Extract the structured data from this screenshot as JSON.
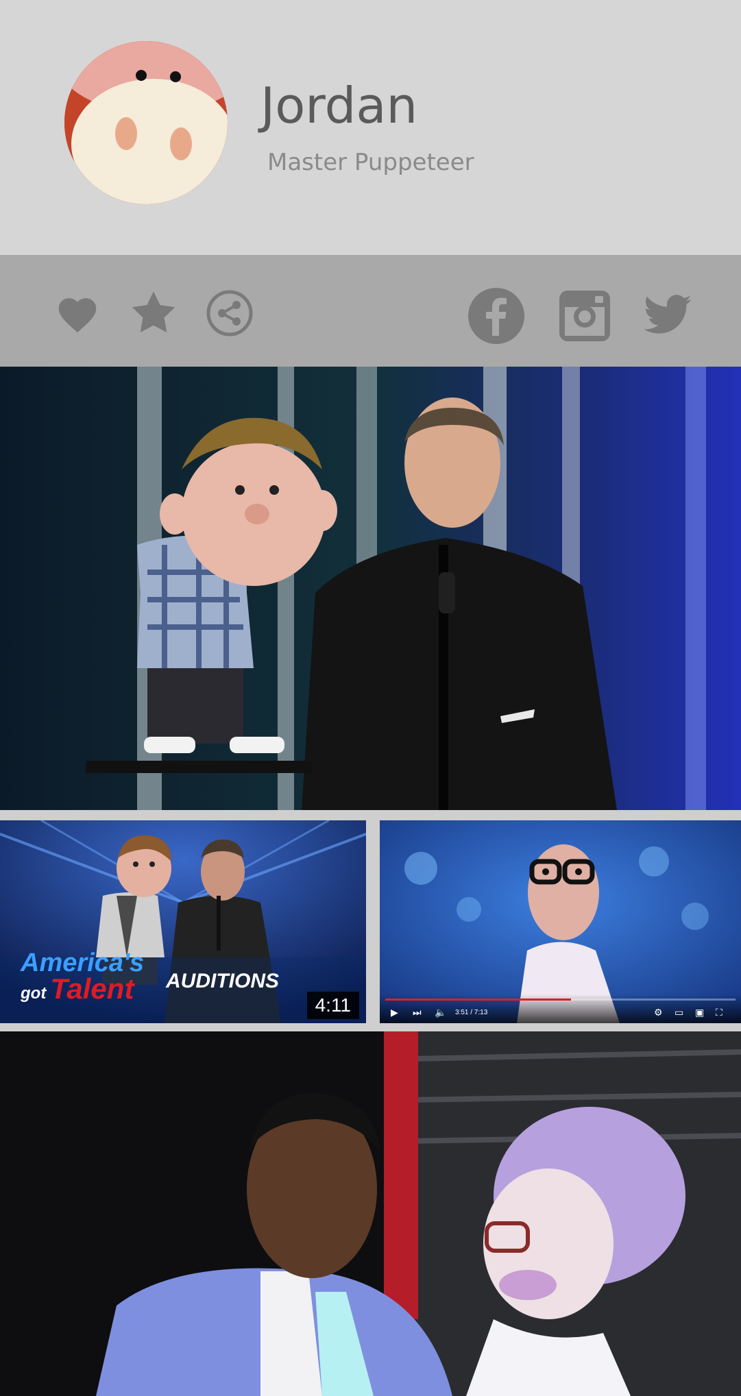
{
  "profile": {
    "name": "Jordan",
    "title": "Master Puppeteer"
  },
  "actions": {
    "left": [
      "heart-icon",
      "star-icon",
      "share-icon"
    ],
    "social": [
      "facebook-icon",
      "instagram-icon",
      "twitter-icon"
    ]
  },
  "gallery": {
    "video_left": {
      "brand_line1": "America's",
      "brand_line2a": "got",
      "brand_line2b": "Talent",
      "caption": "AUDITIONS",
      "duration": "4:11"
    },
    "video_right": {
      "time": "3:51 / 7:13",
      "progress": 0.53
    }
  },
  "colors": {
    "header_bg": "#d6d6d6",
    "action_bar_bg": "#a9a9a9",
    "icon_color": "#7a7a7a",
    "name_color": "#5a5a5a",
    "subtitle_color": "#8a8a8a"
  }
}
